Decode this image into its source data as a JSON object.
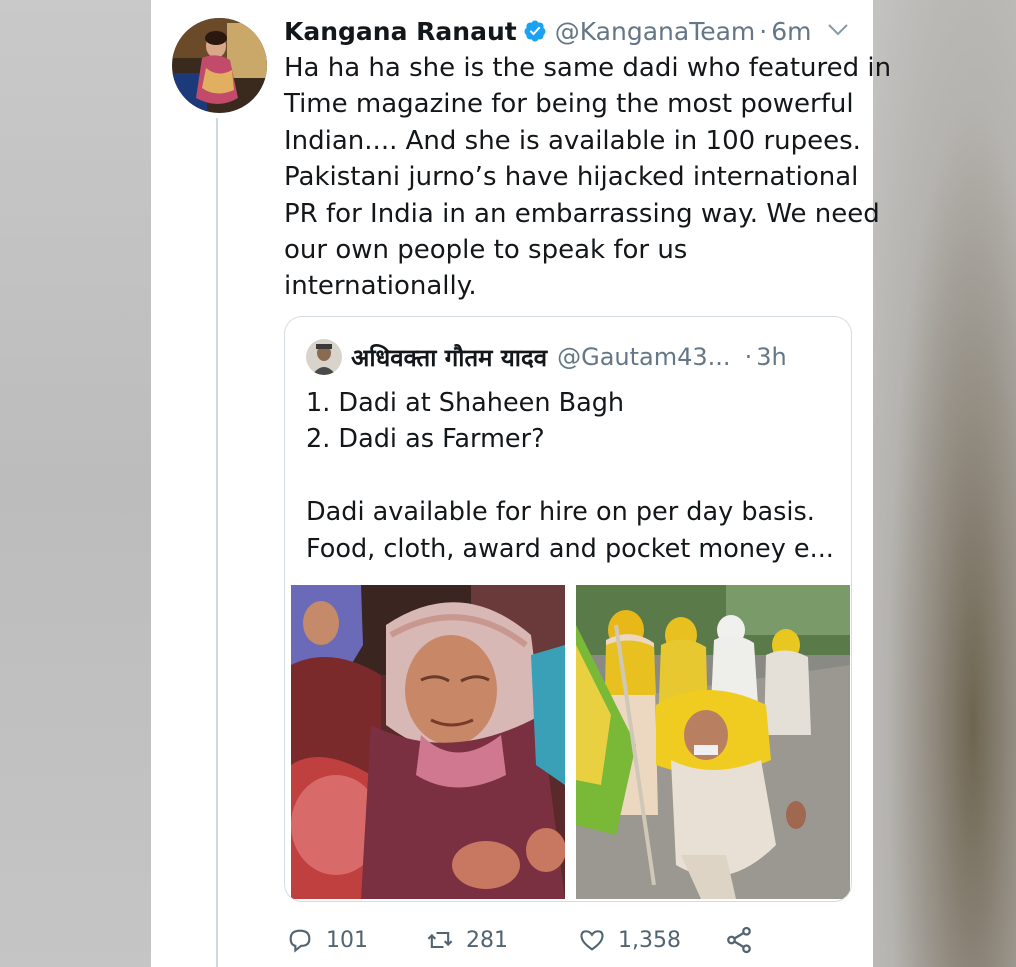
{
  "tweet": {
    "author_name": "Kangana Ranaut",
    "verified": true,
    "handle": "@KanganaTeam",
    "separator": "·",
    "time": "6m",
    "text_lines": [
      "Ha ha ha she is the same dadi who featured in",
      "Time magazine for being the most powerful",
      "Indian.... And she is available in 100 rupees.",
      "Pakistani jurno’s have hijacked international",
      "PR for India in an embarrassing way. We need",
      "our own people to speak for us",
      "internationally."
    ],
    "accent_color": "#1da1f2"
  },
  "quote": {
    "author_name": "अधिवक्ता गौतम यादव",
    "handle": "@Gautam43...",
    "separator": "·",
    "time": "3h",
    "text_lines": [
      "1. Dadi at Shaheen Bagh",
      "2. Dadi as Farmer?",
      "",
      "Dadi available for hire on per day basis.",
      "Food, cloth, award and pocket money e..."
    ],
    "photos": [
      "elderly-woman-shaheen-bagh-photo",
      "elderly-woman-farmer-march-photo"
    ]
  },
  "actions": {
    "reply_count": "101",
    "retweet_count": "281",
    "like_count": "1,358",
    "icons": [
      "reply-icon",
      "retweet-icon",
      "like-icon",
      "share-icon"
    ]
  }
}
